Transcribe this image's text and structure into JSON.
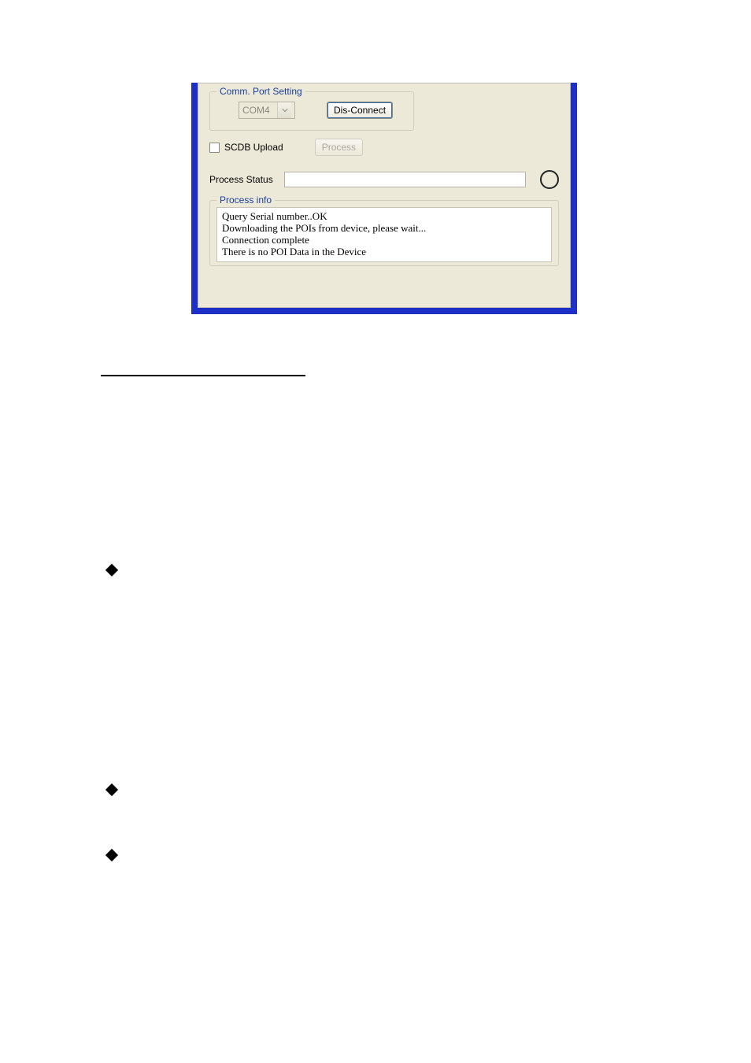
{
  "comm": {
    "legend": "Comm. Port Setting",
    "port": "COM4",
    "button": "Dis-Connect"
  },
  "upload": {
    "checkbox_label": "SCDB Upload",
    "process_button": "Process"
  },
  "status": {
    "label": "Process Status",
    "value": ""
  },
  "process_info": {
    "legend": "Process info",
    "lines": [
      "Query Serial number..OK",
      "Downloading the POIs from device, please wait...",
      "Connection complete",
      "There is no POI Data in the Device"
    ]
  }
}
